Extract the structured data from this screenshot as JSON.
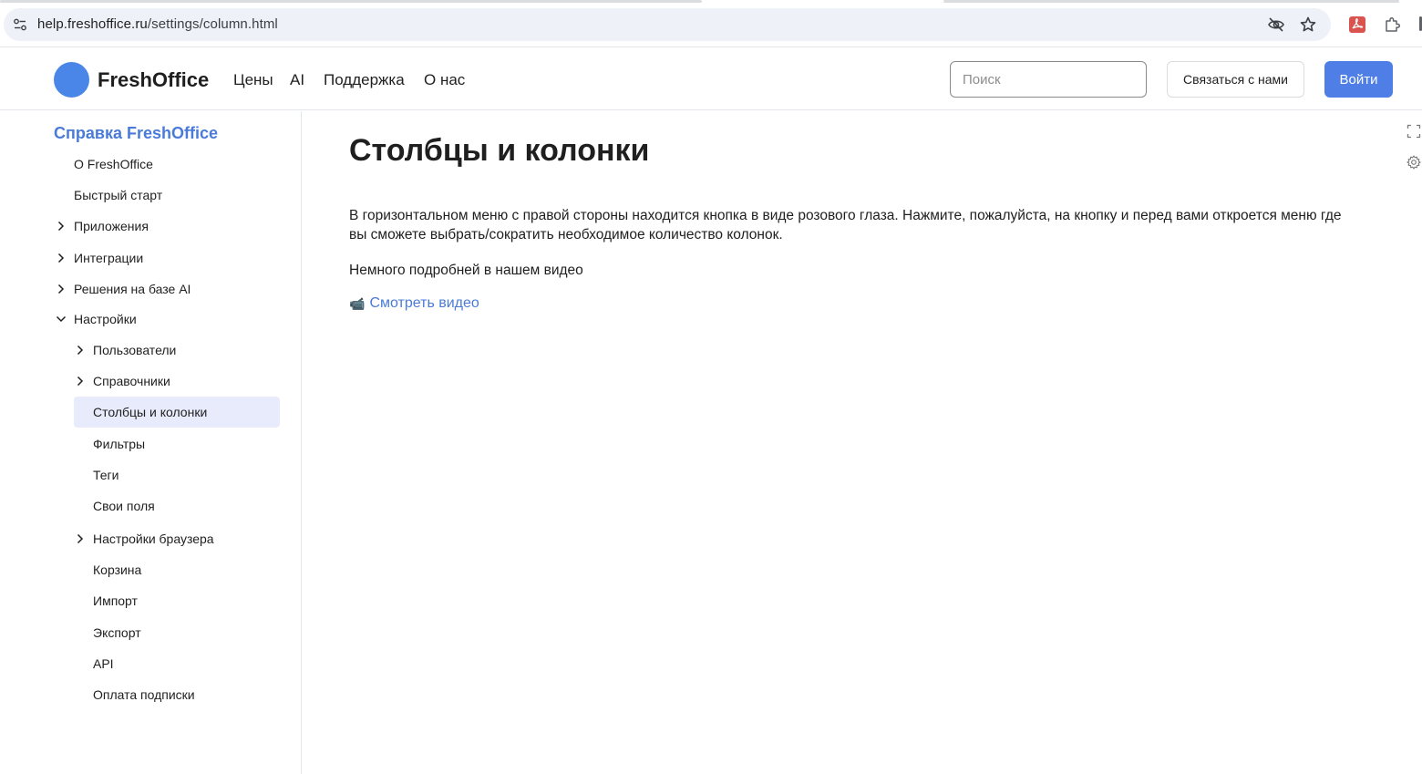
{
  "browser": {
    "url_host": "help.freshoffice.ru",
    "url_path": "/settings/column.html",
    "icons": [
      "site-settings-icon",
      "eye-off-icon",
      "star-icon",
      "pdf-extension-icon",
      "puzzle-extension-icon"
    ]
  },
  "header": {
    "logo_text": "FreshOffice",
    "nav": [
      "Цены",
      "AI",
      "Поддержка",
      "О нас"
    ],
    "search_placeholder": "Поиск",
    "contact_label": "Связаться с нами",
    "login_label": "Войти",
    "accent_color": "#4f7fe6"
  },
  "sidebar": {
    "title": "Справка FreshOffice",
    "items": [
      {
        "label": "О FreshOffice",
        "level": 1,
        "chevron": "none"
      },
      {
        "label": "Быстрый старт",
        "level": 1,
        "chevron": "none"
      },
      {
        "label": "Приложения",
        "level": 1,
        "chevron": "right"
      },
      {
        "label": "Интеграции",
        "level": 1,
        "chevron": "right"
      },
      {
        "label": "Решения на базе AI",
        "level": 1,
        "chevron": "right"
      },
      {
        "label": "Настройки",
        "level": 1,
        "chevron": "down"
      },
      {
        "label": "Пользователи",
        "level": 2,
        "chevron": "right"
      },
      {
        "label": "Справочники",
        "level": 2,
        "chevron": "right"
      },
      {
        "label": "Столбцы и колонки",
        "level": 2,
        "chevron": "none",
        "active": true
      },
      {
        "label": "Фильтры",
        "level": 2,
        "chevron": "none"
      },
      {
        "label": "Теги",
        "level": 2,
        "chevron": "none"
      },
      {
        "label": "Свои поля",
        "level": 2,
        "chevron": "none"
      },
      {
        "label": "Настройки браузера",
        "level": 2,
        "chevron": "right"
      },
      {
        "label": "Корзина",
        "level": 2,
        "chevron": "none"
      },
      {
        "label": "Импорт",
        "level": 2,
        "chevron": "none"
      },
      {
        "label": "Экспорт",
        "level": 2,
        "chevron": "none"
      },
      {
        "label": "API",
        "level": 2,
        "chevron": "none"
      },
      {
        "label": "Оплата подписки",
        "level": 2,
        "chevron": "none"
      }
    ]
  },
  "main": {
    "title": "Столбцы и колонки",
    "paragraph1_line1": "В горизонтальном меню с правой стороны находится кнопка в виде розового глаза. Нажмите, пожалуйста, на кнопку и перед вами откроется меню где",
    "paragraph1_line2": "вы сможете выбрать/сократить необходимое количество колонок.",
    "paragraph2": "Немного подробней в нашем видео",
    "video_icon": "📹",
    "video_link": "Смотреть видео",
    "side_tools": [
      "fullscreen-icon",
      "gear-icon"
    ]
  }
}
